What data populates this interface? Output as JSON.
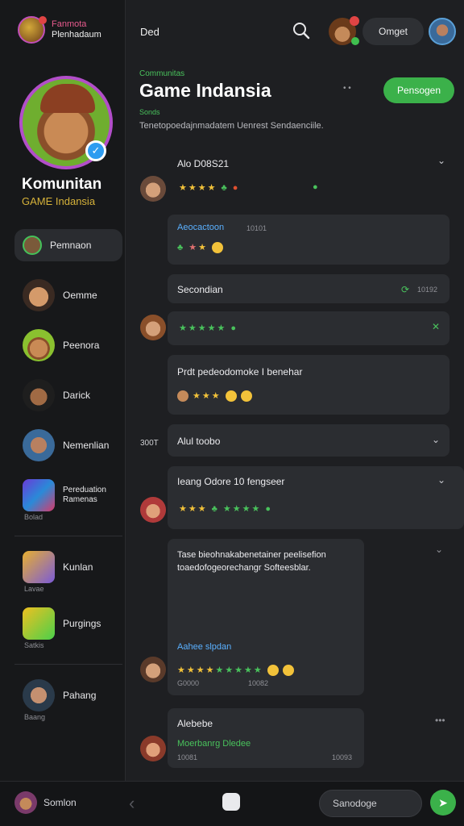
{
  "sidebar": {
    "brand_line1": "Fanmota",
    "brand_line2": "Plenhadaum",
    "hero_title": "Komunitan",
    "hero_subtitle": "GAME Indansia",
    "items": [
      {
        "label": "Pemnaon",
        "sub": ""
      },
      {
        "label": "Oemme",
        "sub": ""
      },
      {
        "label": "Peenora",
        "sub": ""
      },
      {
        "label": "Darick",
        "sub": ""
      },
      {
        "label": "Nemenlian",
        "sub": ""
      },
      {
        "label": "Pereduation Ramenas",
        "sub": "Bolad"
      },
      {
        "label": "Kunlan",
        "sub": "Lavae"
      },
      {
        "label": "Purgings",
        "sub": "Satkis"
      },
      {
        "label": "Pahang",
        "sub": "Baang"
      }
    ]
  },
  "topbar": {
    "title": "Ded",
    "pill_label": "Omget"
  },
  "header": {
    "kicker": "Communitas",
    "title": "Game Indansia",
    "small": "Sonds",
    "description": "Tenetopoedajnmadatem Uenrest Sendaenciile.",
    "join_label": "Pensogen",
    "dots": "• •"
  },
  "feed": {
    "r1_title": "Alo D08S21",
    "r2_tag": "Aeocactoon",
    "r2_meta": "10101",
    "r3_title": "Secondian",
    "r3_meta": "10192",
    "r5_text": "Prdt pedeodomoke I benehar",
    "r6_side": "300T",
    "r6_title": "Alul toobo",
    "r7_title": "Ieang Odore 10 fengseer",
    "r8_text1": "Tase bieohnakabenetainer peelisefion",
    "r8_text2": "toaedofogeorechangr Softeesblar.",
    "r8_tag": "Aahee slpdan",
    "r8_meta1": "G0000",
    "r8_meta2": "10082",
    "r9_title": "Alebebe",
    "r9_sub": "Moerbanrg Dledee",
    "r9_meta1": "10081",
    "r9_meta2": "10093"
  },
  "bottom": {
    "username": "Somlon",
    "input_value": "Sanodoge"
  },
  "colors": {
    "accent_green": "#3bb14a",
    "link_blue": "#5ab0ff",
    "gold": "#d6b23a",
    "avatar_ring": "#b24ec9"
  }
}
